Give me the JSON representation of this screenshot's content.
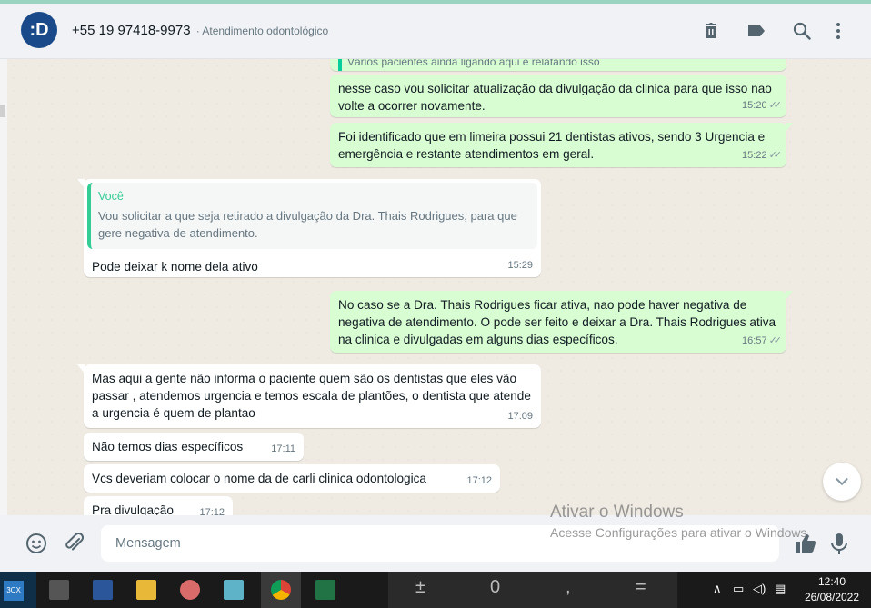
{
  "header": {
    "avatar_text": ":D",
    "phone": "+55 19 97418-9973",
    "subtitle": "· Atendimento odontológico",
    "icons": [
      "trash-icon",
      "label-icon",
      "search-icon",
      "menu-icon"
    ]
  },
  "messages": {
    "partial_top": "Vários pacientes ainda ligando aqui e relatando isso",
    "m1": {
      "text": "nesse caso vou solicitar atualização da divulgação da clinica para que isso nao volte a ocorrer novamente.",
      "time": "15:20"
    },
    "m2": {
      "text": "Foi identificado que em limeira possui 21 dentistas ativos, sendo 3 Urgencia e emergência e restante atendimentos em geral.",
      "time": "15:22"
    },
    "m3": {
      "quote_author": "Você",
      "quote_text": "Vou solicitar a que seja retirado a divulgação da Dra. Thais Rodrigues, para que gere negativa de atendimento.",
      "text": "Pode deixar k nome dela ativo",
      "time": "15:29"
    },
    "m4": {
      "text": "No caso se a Dra. Thais Rodrigues ficar ativa, nao pode haver negativa de negativa de atendimento. O pode ser feito e deixar a Dra. Thais Rodrigues ativa na clinica e divulgadas em alguns dias específicos.",
      "time": "16:57"
    },
    "m5": {
      "text": "Mas aqui a gente não informa o paciente  quem são os dentistas que eles vão passar , atendemos urgencia  e temos escala de plantões,  o dentista que atende a urgencia é  quem de plantao",
      "time": "17:09"
    },
    "m6": {
      "text": "Não temos dias específicos",
      "time": "17:11"
    },
    "m7": {
      "text": "Vcs deveriam colocar o nome da de carli clinica  odontologica",
      "time": "17:12"
    },
    "m8": {
      "text": "Pra divulgação",
      "time": "17:12"
    }
  },
  "composer": {
    "placeholder": "Mensagem"
  },
  "watermark": {
    "title": "Ativar o Windows",
    "subtitle": "Acesse Configurações para ativar o Windows."
  },
  "taskbar": {
    "start_label": "3CX",
    "apps": [
      "calculator-icon",
      "word-icon",
      "file-explorer-icon",
      "paint-icon",
      "notepad-icon",
      "chrome-icon",
      "excel-icon"
    ],
    "calc_ghost": [
      "±",
      "0",
      ",",
      "="
    ],
    "time": "12:40",
    "date": "26/08/2022"
  },
  "colors": {
    "outgoing": "#d9fdd3",
    "incoming": "#ffffff",
    "accent": "#35cd96",
    "avatar": "#1a4a8a"
  }
}
